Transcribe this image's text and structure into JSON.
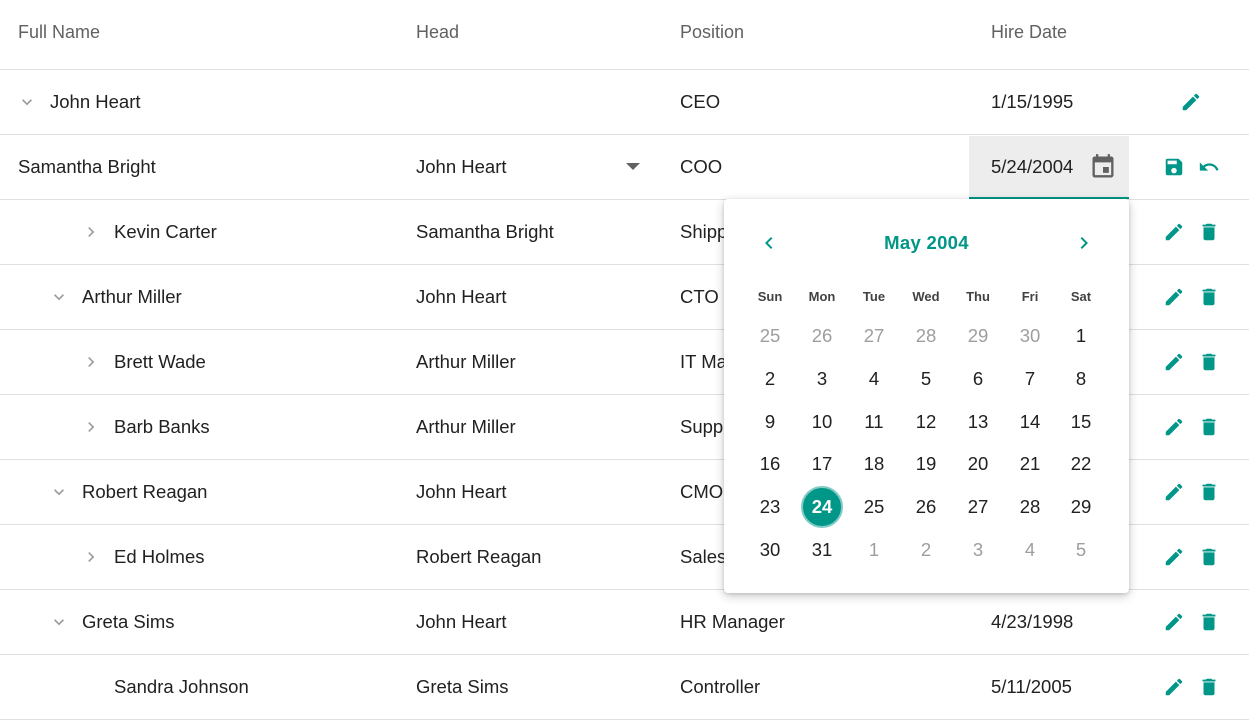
{
  "columns": {
    "full_name": "Full Name",
    "head": "Head",
    "position": "Position",
    "hire_date": "Hire Date"
  },
  "rows": [
    {
      "name": "John Heart",
      "head": "",
      "position": "CEO",
      "hire_date": "1/15/1995",
      "level": 0,
      "expander": "expanded",
      "actions": [
        "edit"
      ]
    },
    {
      "name": "Samantha Bright",
      "head": "John Heart",
      "position": "COO",
      "hire_date": "5/24/2004",
      "level": 0,
      "expander": "none",
      "editing": true,
      "actions": [
        "save",
        "undo"
      ]
    },
    {
      "name": "Kevin Carter",
      "head": "Samantha Bright",
      "position": "Shipp",
      "hire_date": "",
      "level": 2,
      "expander": "collapsed",
      "actions": [
        "edit",
        "delete"
      ]
    },
    {
      "name": "Arthur Miller",
      "head": "John Heart",
      "position": "CTO",
      "hire_date": "",
      "level": 1,
      "expander": "expanded",
      "actions": [
        "edit",
        "delete"
      ]
    },
    {
      "name": "Brett Wade",
      "head": "Arthur Miller",
      "position": "IT Ma",
      "hire_date": "",
      "level": 2,
      "expander": "collapsed",
      "actions": [
        "edit",
        "delete"
      ]
    },
    {
      "name": "Barb Banks",
      "head": "Arthur Miller",
      "position": "Suppo",
      "hire_date": "",
      "level": 2,
      "expander": "collapsed",
      "actions": [
        "edit",
        "delete"
      ]
    },
    {
      "name": "Robert Reagan",
      "head": "John Heart",
      "position": "CMO",
      "hire_date": "",
      "level": 1,
      "expander": "expanded",
      "actions": [
        "edit",
        "delete"
      ]
    },
    {
      "name": "Ed Holmes",
      "head": "Robert Reagan",
      "position": "Sales",
      "hire_date": "",
      "level": 2,
      "expander": "collapsed",
      "actions": [
        "edit",
        "delete"
      ]
    },
    {
      "name": "Greta Sims",
      "head": "John Heart",
      "position": "HR Manager",
      "hire_date": "4/23/1998",
      "level": 1,
      "expander": "expanded",
      "actions": [
        "edit",
        "delete"
      ]
    },
    {
      "name": "Sandra Johnson",
      "head": "Greta Sims",
      "position": "Controller",
      "hire_date": "5/11/2005",
      "level": 2,
      "expander": "none",
      "actions": [
        "edit",
        "delete"
      ]
    }
  ],
  "calendar": {
    "title": "May 2004",
    "weekdays": [
      "Sun",
      "Mon",
      "Tue",
      "Wed",
      "Thu",
      "Fri",
      "Sat"
    ],
    "weeks": [
      [
        [
          "25",
          true
        ],
        [
          "26",
          true
        ],
        [
          "27",
          true
        ],
        [
          "28",
          true
        ],
        [
          "29",
          true
        ],
        [
          "30",
          true
        ],
        [
          "1",
          false
        ]
      ],
      [
        [
          "2",
          false
        ],
        [
          "3",
          false
        ],
        [
          "4",
          false
        ],
        [
          "5",
          false
        ],
        [
          "6",
          false
        ],
        [
          "7",
          false
        ],
        [
          "8",
          false
        ]
      ],
      [
        [
          "9",
          false
        ],
        [
          "10",
          false
        ],
        [
          "11",
          false
        ],
        [
          "12",
          false
        ],
        [
          "13",
          false
        ],
        [
          "14",
          false
        ],
        [
          "15",
          false
        ]
      ],
      [
        [
          "16",
          false
        ],
        [
          "17",
          false
        ],
        [
          "18",
          false
        ],
        [
          "19",
          false
        ],
        [
          "20",
          false
        ],
        [
          "21",
          false
        ],
        [
          "22",
          false
        ]
      ],
      [
        [
          "23",
          false
        ],
        [
          "24",
          false
        ],
        [
          "25",
          false
        ],
        [
          "26",
          false
        ],
        [
          "27",
          false
        ],
        [
          "28",
          false
        ],
        [
          "29",
          false
        ]
      ],
      [
        [
          "30",
          false
        ],
        [
          "31",
          false
        ],
        [
          "1",
          true
        ],
        [
          "2",
          true
        ],
        [
          "3",
          true
        ],
        [
          "4",
          true
        ],
        [
          "5",
          true
        ]
      ]
    ],
    "selected_day": "24"
  },
  "colors": {
    "accent": "#009688",
    "accent_light": "#80cbc4",
    "muted_text": "#9e9e9e",
    "header_text": "#616161",
    "editor_bg": "#ededed"
  },
  "icons": {
    "edit": "pencil-icon",
    "delete": "trash-icon",
    "save": "floppy-disk-icon",
    "undo": "undo-icon",
    "calendar": "calendar-icon",
    "prev": "chevron-left-icon",
    "next": "chevron-right-icon",
    "expanded": "chevron-down-icon",
    "collapsed": "chevron-right-icon",
    "dropdown": "caret-down-icon"
  }
}
